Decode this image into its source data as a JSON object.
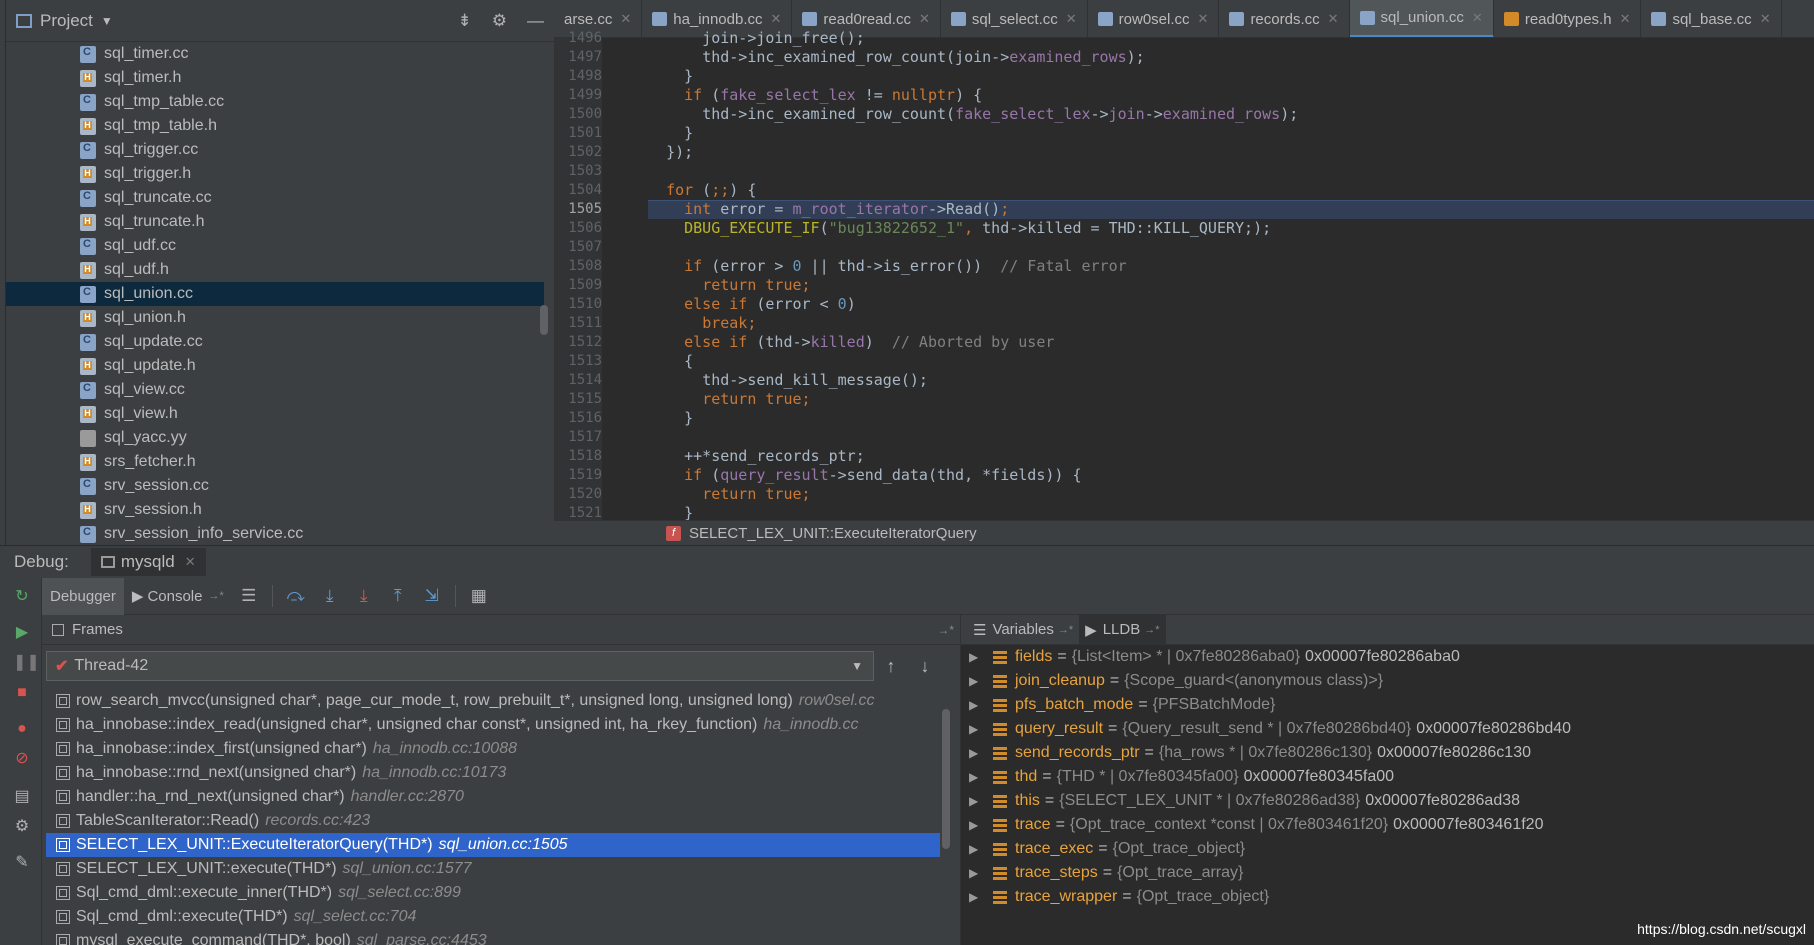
{
  "project": {
    "title": "Project",
    "files": [
      {
        "name": "sql_timer.cc",
        "kind": "cc"
      },
      {
        "name": "sql_timer.h",
        "kind": "h"
      },
      {
        "name": "sql_tmp_table.cc",
        "kind": "cc"
      },
      {
        "name": "sql_tmp_table.h",
        "kind": "h"
      },
      {
        "name": "sql_trigger.cc",
        "kind": "cc"
      },
      {
        "name": "sql_trigger.h",
        "kind": "h"
      },
      {
        "name": "sql_truncate.cc",
        "kind": "cc"
      },
      {
        "name": "sql_truncate.h",
        "kind": "h"
      },
      {
        "name": "sql_udf.cc",
        "kind": "cc"
      },
      {
        "name": "sql_udf.h",
        "kind": "h"
      },
      {
        "name": "sql_union.cc",
        "kind": "cc",
        "selected": true
      },
      {
        "name": "sql_union.h",
        "kind": "h"
      },
      {
        "name": "sql_update.cc",
        "kind": "cc"
      },
      {
        "name": "sql_update.h",
        "kind": "h"
      },
      {
        "name": "sql_view.cc",
        "kind": "cc"
      },
      {
        "name": "sql_view.h",
        "kind": "h"
      },
      {
        "name": "sql_yacc.yy",
        "kind": "yy"
      },
      {
        "name": "srs_fetcher.h",
        "kind": "h"
      },
      {
        "name": "srv_session.cc",
        "kind": "cc"
      },
      {
        "name": "srv_session.h",
        "kind": "h"
      },
      {
        "name": "srv_session_info_service.cc",
        "kind": "cc"
      }
    ]
  },
  "editor": {
    "tabs": [
      {
        "label": "arse.cc",
        "kind": "none"
      },
      {
        "label": "ha_innodb.cc",
        "kind": "cc"
      },
      {
        "label": "read0read.cc",
        "kind": "cc"
      },
      {
        "label": "sql_select.cc",
        "kind": "cc"
      },
      {
        "label": "row0sel.cc",
        "kind": "cc"
      },
      {
        "label": "records.cc",
        "kind": "cc"
      },
      {
        "label": "sql_union.cc",
        "kind": "cc",
        "active": true
      },
      {
        "label": "read0types.h",
        "kind": "h"
      },
      {
        "label": "sql_base.cc",
        "kind": "cc"
      }
    ],
    "current_line": 1505,
    "lines": [
      {
        "n": "1496",
        "html": "      <span class='plain'>join->join_free();</span>"
      },
      {
        "n": "1497",
        "html": "      <span class='plain'>thd->inc_examined_row_count(join-></span><span class='mem'>examined_rows</span><span class='plain'>);</span>"
      },
      {
        "n": "1498",
        "html": "    <span class='plain'>}</span>"
      },
      {
        "n": "1499",
        "html": "    <span class='kw'>if</span><span class='plain'> (</span><span class='mem'>fake_select_lex</span><span class='plain'> != </span><span class='kw'>nullptr</span><span class='plain'>) {</span>"
      },
      {
        "n": "1500",
        "html": "      <span class='plain'>thd->inc_examined_row_count(</span><span class='mem'>fake_select_lex</span><span class='plain'>-></span><span class='mem'>join</span><span class='plain'>-></span><span class='mem'>examined_rows</span><span class='plain'>);</span>"
      },
      {
        "n": "1501",
        "html": "    <span class='plain'>}</span>"
      },
      {
        "n": "1502",
        "html": "  <span class='plain'>});</span>"
      },
      {
        "n": "1503",
        "html": ""
      },
      {
        "n": "1504",
        "html": "  <span class='kw'>for</span><span class='plain'> (</span><span class='kw'>;;</span><span class='plain'>) {</span>"
      },
      {
        "n": "1505",
        "html": "    <span class='kw'>int</span><span class='plain'> error = </span><span class='mem'>m_root_iterator</span><span class='plain'>->Read()</span><span class='kw'>;</span>"
      },
      {
        "n": "1506",
        "html": "    <span class='mac'>DBUG_EXECUTE_IF</span><span class='plain'>(</span><span class='str'>\"bug13822652_1\"</span><span class='kw'>,</span><span class='plain'> thd->killed = THD::KILL_QUERY;);</span>"
      },
      {
        "n": "1507",
        "html": ""
      },
      {
        "n": "1508",
        "html": "    <span class='kw'>if</span><span class='plain'> (error > </span><span class='num'>0</span><span class='plain'> || thd->is_error())  </span><span class='cmt'>// Fatal error</span>"
      },
      {
        "n": "1509",
        "html": "      <span class='kw'>return true;</span>"
      },
      {
        "n": "1510",
        "html": "    <span class='kw'>else if</span><span class='plain'> (error < </span><span class='num'>0</span><span class='plain'>)</span>"
      },
      {
        "n": "1511",
        "html": "      <span class='kw'>break;</span>"
      },
      {
        "n": "1512",
        "html": "    <span class='kw'>else if</span><span class='plain'> (thd-></span><span class='mem'>killed</span><span class='plain'>)  </span><span class='cmt'>// Aborted by user</span>"
      },
      {
        "n": "1513",
        "html": "    <span class='plain'>{</span>"
      },
      {
        "n": "1514",
        "html": "      <span class='plain'>thd->send_kill_message();</span>"
      },
      {
        "n": "1515",
        "html": "      <span class='kw'>return true;</span>"
      },
      {
        "n": "1516",
        "html": "    <span class='plain'>}</span>"
      },
      {
        "n": "1517",
        "html": ""
      },
      {
        "n": "1518",
        "html": "    <span class='plain'>++*send_records_ptr;</span>"
      },
      {
        "n": "1519",
        "html": "    <span class='kw'>if</span><span class='plain'> (</span><span class='mem'>query_result</span><span class='plain'>->send_data(thd, *fields)) {</span>"
      },
      {
        "n": "1520",
        "html": "      <span class='kw'>return true;</span>"
      },
      {
        "n": "1521",
        "html": "    <span class='plain'>}</span>"
      }
    ],
    "breadcrumb": "SELECT_LEX_UNIT::ExecuteIteratorQuery"
  },
  "debug": {
    "label": "Debug:",
    "session": "mysqld",
    "tabs": {
      "debugger": "Debugger",
      "console": "Console"
    },
    "frames_title": "Frames",
    "thread": "Thread-42",
    "frames": [
      {
        "fn": "row_search_mvcc(unsigned char*, page_cur_mode_t, row_prebuilt_t*, unsigned long, unsigned long)",
        "loc": "row0sel.cc"
      },
      {
        "fn": "ha_innobase::index_read(unsigned char*, unsigned char const*, unsigned int, ha_rkey_function)",
        "loc": "ha_innodb.cc"
      },
      {
        "fn": "ha_innobase::index_first(unsigned char*)",
        "loc": "ha_innodb.cc:10088"
      },
      {
        "fn": "ha_innobase::rnd_next(unsigned char*)",
        "loc": "ha_innodb.cc:10173"
      },
      {
        "fn": "handler::ha_rnd_next(unsigned char*)",
        "loc": "handler.cc:2870"
      },
      {
        "fn": "TableScanIterator::Read()",
        "loc": "records.cc:423"
      },
      {
        "fn": "SELECT_LEX_UNIT::ExecuteIteratorQuery(THD*)",
        "loc": "sql_union.cc:1505",
        "selected": true
      },
      {
        "fn": "SELECT_LEX_UNIT::execute(THD*)",
        "loc": "sql_union.cc:1577"
      },
      {
        "fn": "Sql_cmd_dml::execute_inner(THD*)",
        "loc": "sql_select.cc:899"
      },
      {
        "fn": "Sql_cmd_dml::execute(THD*)",
        "loc": "sql_select.cc:704"
      },
      {
        "fn": "mysql_execute_command(THD*, bool)",
        "loc": "sql_parse.cc:4453"
      }
    ],
    "variables_title": "Variables",
    "lldb_title": "LLDB",
    "variables": [
      {
        "name": "fields",
        "type": "{List<Item> * | 0x7fe80286aba0}",
        "value": "0x00007fe80286aba0"
      },
      {
        "name": "join_cleanup",
        "type": "{Scope_guard<(anonymous class)>}",
        "value": ""
      },
      {
        "name": "pfs_batch_mode",
        "type": "{PFSBatchMode}",
        "value": ""
      },
      {
        "name": "query_result",
        "type": "{Query_result_send * | 0x7fe80286bd40}",
        "value": "0x00007fe80286bd40"
      },
      {
        "name": "send_records_ptr",
        "type": "{ha_rows * | 0x7fe80286c130}",
        "value": "0x00007fe80286c130"
      },
      {
        "name": "thd",
        "type": "{THD * | 0x7fe80345fa00}",
        "value": "0x00007fe80345fa00"
      },
      {
        "name": "this",
        "type": "{SELECT_LEX_UNIT * | 0x7fe80286ad38}",
        "value": "0x00007fe80286ad38"
      },
      {
        "name": "trace",
        "type": "{Opt_trace_context *const | 0x7fe803461f20}",
        "value": "0x00007fe803461f20"
      },
      {
        "name": "trace_exec",
        "type": "{Opt_trace_object}",
        "value": ""
      },
      {
        "name": "trace_steps",
        "type": "{Opt_trace_array}",
        "value": ""
      },
      {
        "name": "trace_wrapper",
        "type": "{Opt_trace_object}",
        "value": ""
      }
    ]
  },
  "watermark": "https://blog.csdn.net/scugxl"
}
